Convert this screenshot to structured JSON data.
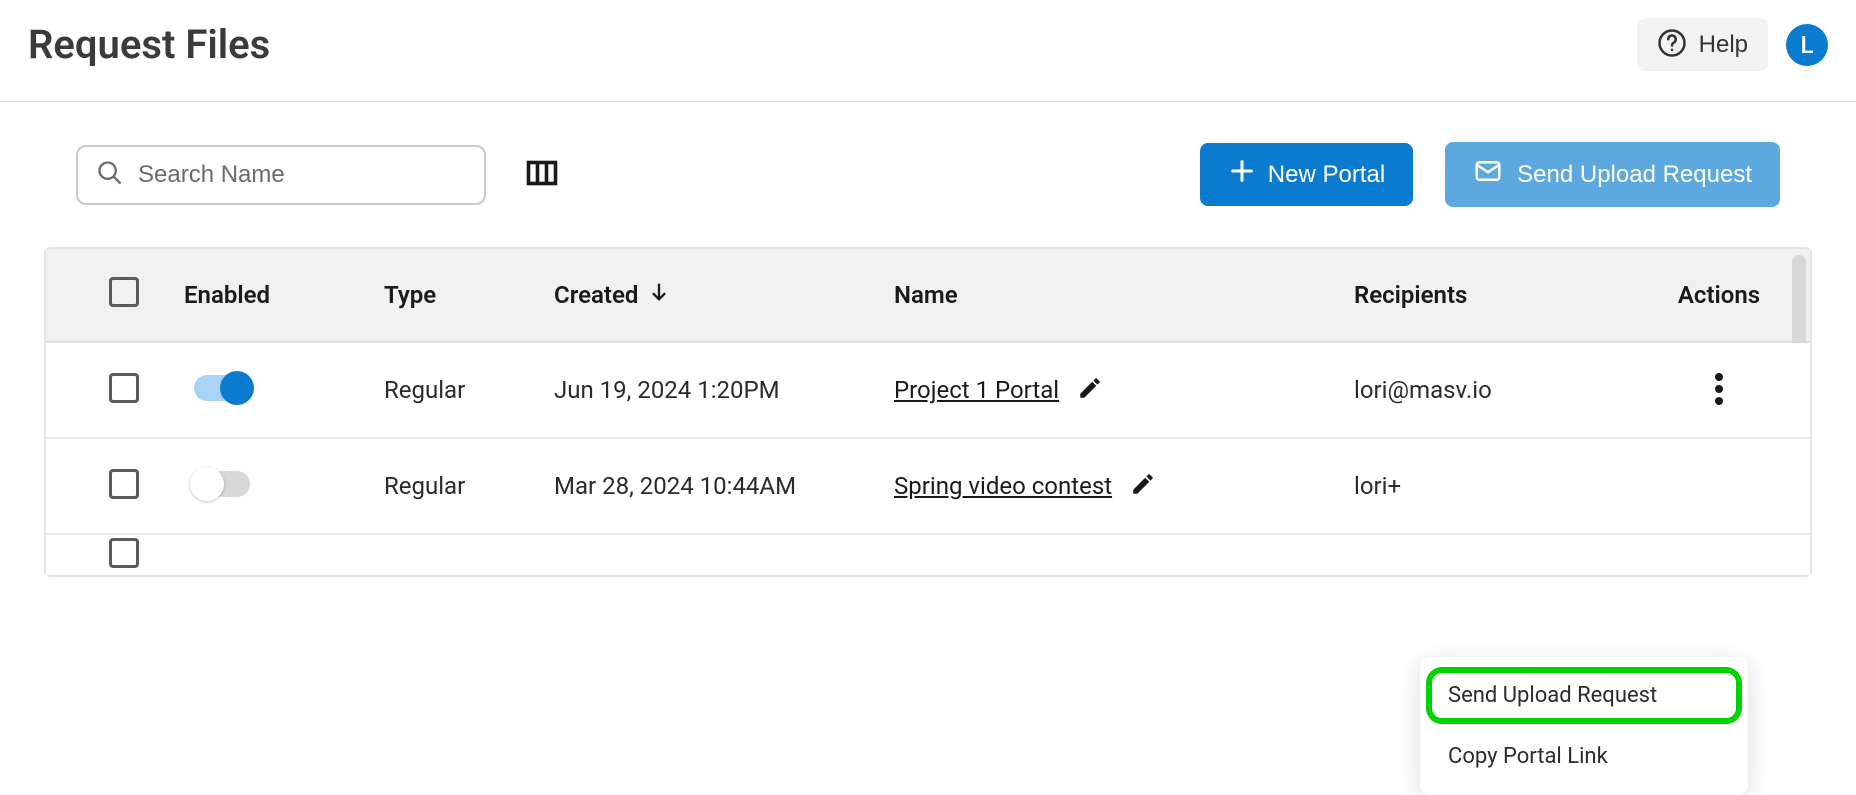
{
  "header": {
    "title": "Request Files",
    "help_label": "Help",
    "avatar_initial": "L"
  },
  "toolbar": {
    "search_placeholder": "Search Name",
    "new_portal_label": "New Portal",
    "send_upload_request_label": "Send Upload Request"
  },
  "table": {
    "columns": {
      "enabled": "Enabled",
      "type": "Type",
      "created": "Created",
      "name": "Name",
      "recipients": "Recipients",
      "actions": "Actions"
    },
    "rows": [
      {
        "enabled": true,
        "type": "Regular",
        "created": "Jun 19, 2024 1:20PM",
        "name": "Project 1 Portal",
        "recipients": "lori@masv.io"
      },
      {
        "enabled": false,
        "type": "Regular",
        "created": "Mar 28, 2024 10:44AM",
        "name": "Spring video contest",
        "recipients": "lori+"
      }
    ]
  },
  "dropdown": {
    "send_upload_request": "Send Upload Request",
    "copy_portal_link": "Copy Portal Link"
  }
}
